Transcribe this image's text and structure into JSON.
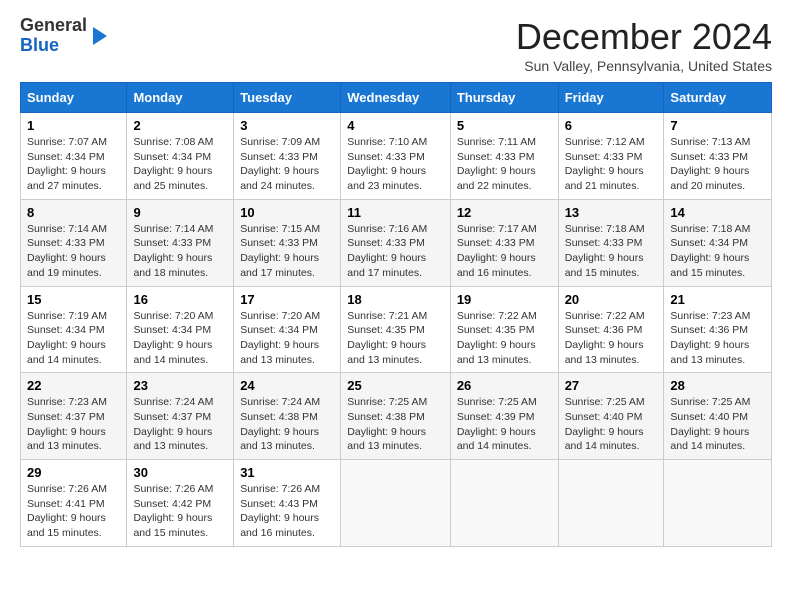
{
  "header": {
    "logo_line1": "General",
    "logo_line2": "Blue",
    "month_title": "December 2024",
    "location": "Sun Valley, Pennsylvania, United States"
  },
  "weekdays": [
    "Sunday",
    "Monday",
    "Tuesday",
    "Wednesday",
    "Thursday",
    "Friday",
    "Saturday"
  ],
  "weeks": [
    [
      {
        "day": "1",
        "info": "Sunrise: 7:07 AM\nSunset: 4:34 PM\nDaylight: 9 hours\nand 27 minutes."
      },
      {
        "day": "2",
        "info": "Sunrise: 7:08 AM\nSunset: 4:34 PM\nDaylight: 9 hours\nand 25 minutes."
      },
      {
        "day": "3",
        "info": "Sunrise: 7:09 AM\nSunset: 4:33 PM\nDaylight: 9 hours\nand 24 minutes."
      },
      {
        "day": "4",
        "info": "Sunrise: 7:10 AM\nSunset: 4:33 PM\nDaylight: 9 hours\nand 23 minutes."
      },
      {
        "day": "5",
        "info": "Sunrise: 7:11 AM\nSunset: 4:33 PM\nDaylight: 9 hours\nand 22 minutes."
      },
      {
        "day": "6",
        "info": "Sunrise: 7:12 AM\nSunset: 4:33 PM\nDaylight: 9 hours\nand 21 minutes."
      },
      {
        "day": "7",
        "info": "Sunrise: 7:13 AM\nSunset: 4:33 PM\nDaylight: 9 hours\nand 20 minutes."
      }
    ],
    [
      {
        "day": "8",
        "info": "Sunrise: 7:14 AM\nSunset: 4:33 PM\nDaylight: 9 hours\nand 19 minutes."
      },
      {
        "day": "9",
        "info": "Sunrise: 7:14 AM\nSunset: 4:33 PM\nDaylight: 9 hours\nand 18 minutes."
      },
      {
        "day": "10",
        "info": "Sunrise: 7:15 AM\nSunset: 4:33 PM\nDaylight: 9 hours\nand 17 minutes."
      },
      {
        "day": "11",
        "info": "Sunrise: 7:16 AM\nSunset: 4:33 PM\nDaylight: 9 hours\nand 17 minutes."
      },
      {
        "day": "12",
        "info": "Sunrise: 7:17 AM\nSunset: 4:33 PM\nDaylight: 9 hours\nand 16 minutes."
      },
      {
        "day": "13",
        "info": "Sunrise: 7:18 AM\nSunset: 4:33 PM\nDaylight: 9 hours\nand 15 minutes."
      },
      {
        "day": "14",
        "info": "Sunrise: 7:18 AM\nSunset: 4:34 PM\nDaylight: 9 hours\nand 15 minutes."
      }
    ],
    [
      {
        "day": "15",
        "info": "Sunrise: 7:19 AM\nSunset: 4:34 PM\nDaylight: 9 hours\nand 14 minutes."
      },
      {
        "day": "16",
        "info": "Sunrise: 7:20 AM\nSunset: 4:34 PM\nDaylight: 9 hours\nand 14 minutes."
      },
      {
        "day": "17",
        "info": "Sunrise: 7:20 AM\nSunset: 4:34 PM\nDaylight: 9 hours\nand 13 minutes."
      },
      {
        "day": "18",
        "info": "Sunrise: 7:21 AM\nSunset: 4:35 PM\nDaylight: 9 hours\nand 13 minutes."
      },
      {
        "day": "19",
        "info": "Sunrise: 7:22 AM\nSunset: 4:35 PM\nDaylight: 9 hours\nand 13 minutes."
      },
      {
        "day": "20",
        "info": "Sunrise: 7:22 AM\nSunset: 4:36 PM\nDaylight: 9 hours\nand 13 minutes."
      },
      {
        "day": "21",
        "info": "Sunrise: 7:23 AM\nSunset: 4:36 PM\nDaylight: 9 hours\nand 13 minutes."
      }
    ],
    [
      {
        "day": "22",
        "info": "Sunrise: 7:23 AM\nSunset: 4:37 PM\nDaylight: 9 hours\nand 13 minutes."
      },
      {
        "day": "23",
        "info": "Sunrise: 7:24 AM\nSunset: 4:37 PM\nDaylight: 9 hours\nand 13 minutes."
      },
      {
        "day": "24",
        "info": "Sunrise: 7:24 AM\nSunset: 4:38 PM\nDaylight: 9 hours\nand 13 minutes."
      },
      {
        "day": "25",
        "info": "Sunrise: 7:25 AM\nSunset: 4:38 PM\nDaylight: 9 hours\nand 13 minutes."
      },
      {
        "day": "26",
        "info": "Sunrise: 7:25 AM\nSunset: 4:39 PM\nDaylight: 9 hours\nand 14 minutes."
      },
      {
        "day": "27",
        "info": "Sunrise: 7:25 AM\nSunset: 4:40 PM\nDaylight: 9 hours\nand 14 minutes."
      },
      {
        "day": "28",
        "info": "Sunrise: 7:25 AM\nSunset: 4:40 PM\nDaylight: 9 hours\nand 14 minutes."
      }
    ],
    [
      {
        "day": "29",
        "info": "Sunrise: 7:26 AM\nSunset: 4:41 PM\nDaylight: 9 hours\nand 15 minutes."
      },
      {
        "day": "30",
        "info": "Sunrise: 7:26 AM\nSunset: 4:42 PM\nDaylight: 9 hours\nand 15 minutes."
      },
      {
        "day": "31",
        "info": "Sunrise: 7:26 AM\nSunset: 4:43 PM\nDaylight: 9 hours\nand 16 minutes."
      },
      {
        "day": "",
        "info": ""
      },
      {
        "day": "",
        "info": ""
      },
      {
        "day": "",
        "info": ""
      },
      {
        "day": "",
        "info": ""
      }
    ]
  ]
}
